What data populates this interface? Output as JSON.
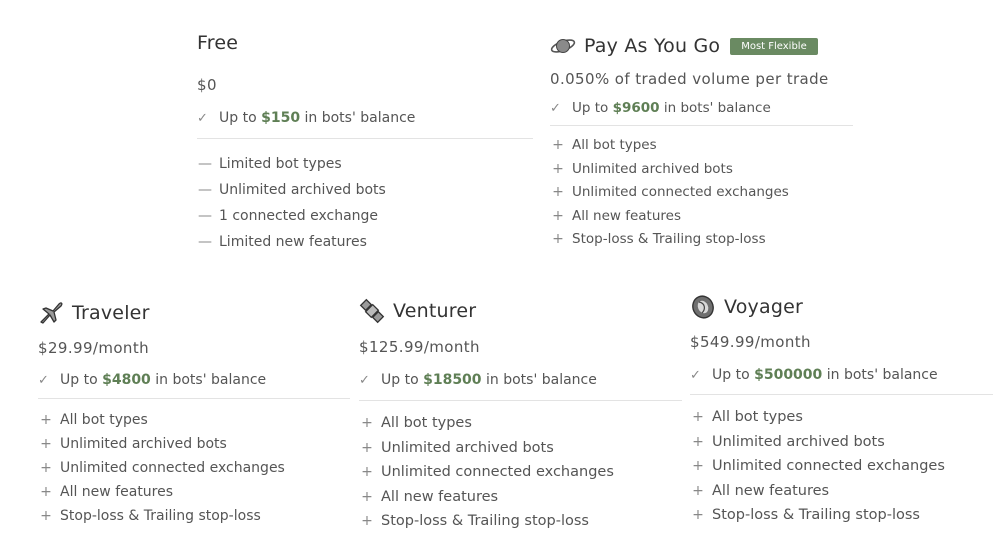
{
  "colors": {
    "accent": "#5f7f55",
    "badge_bg": "#6a8a62",
    "rule": "#e3e3e3"
  },
  "plans": [
    {
      "name": "Free",
      "icon": "",
      "badge": "",
      "price": "$0",
      "balance": {
        "pre": "Up to",
        "amount": "$150",
        "post": "in bots' balance"
      },
      "marker": "minus-icon",
      "features": [
        "Limited bot types",
        "Unlimited archived bots",
        "1 connected exchange",
        "Limited new features"
      ]
    },
    {
      "name": "Pay As You Go",
      "icon": "planet-icon",
      "badge": "Most Flexible",
      "price": "0.050% of traded volume per trade",
      "balance": {
        "pre": "Up to",
        "amount": "$9600",
        "post": "in bots' balance"
      },
      "marker": "plus-icon",
      "features": [
        "All bot types",
        "Unlimited archived bots",
        "Unlimited connected exchanges",
        "All new features",
        "Stop-loss & Trailing stop-loss"
      ]
    },
    {
      "name": "Traveler",
      "icon": "airplane-icon",
      "badge": "",
      "price": "$29.99/month",
      "balance": {
        "pre": "Up to",
        "amount": "$4800",
        "post": "in bots' balance"
      },
      "marker": "plus-icon",
      "features": [
        "All bot types",
        "Unlimited archived bots",
        "Unlimited connected exchanges",
        "All new features",
        "Stop-loss & Trailing stop-loss"
      ]
    },
    {
      "name": "Venturer",
      "icon": "satellite-icon",
      "badge": "",
      "price": "$125.99/month",
      "balance": {
        "pre": "Up to",
        "amount": "$18500",
        "post": "in bots' balance"
      },
      "marker": "plus-icon",
      "features": [
        "All bot types",
        "Unlimited archived bots",
        "Unlimited connected exchanges",
        "All new features",
        "Stop-loss & Trailing stop-loss"
      ]
    },
    {
      "name": "Voyager",
      "icon": "galaxy-icon",
      "badge": "",
      "price": "$549.99/month",
      "balance": {
        "pre": "Up to",
        "amount": "$500000",
        "post": "in bots' balance"
      },
      "marker": "plus-icon",
      "features": [
        "All bot types",
        "Unlimited archived bots",
        "Unlimited connected exchanges",
        "All new features",
        "Stop-loss & Trailing stop-loss"
      ]
    }
  ]
}
